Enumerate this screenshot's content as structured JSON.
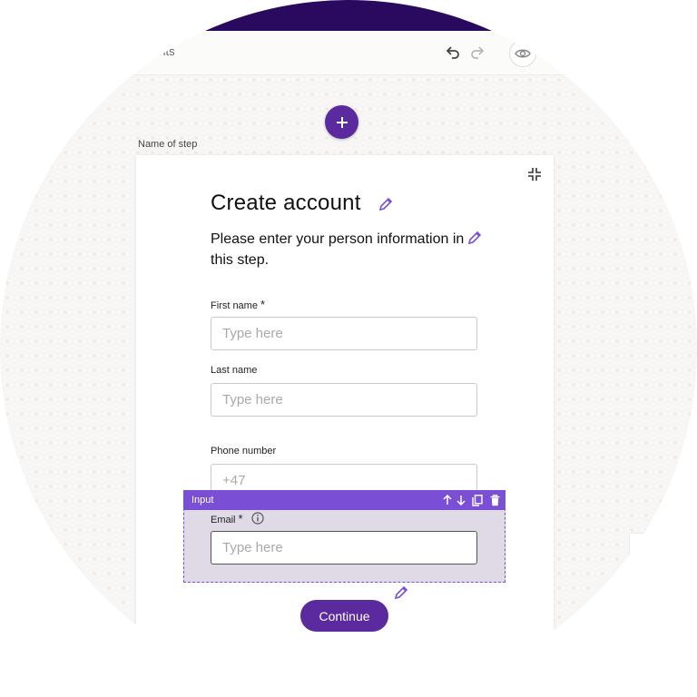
{
  "toolbar": {
    "title": "ements",
    "undo_icon": "undo-icon",
    "redo_icon": "redo-icon",
    "preview_icon": "eye-icon"
  },
  "canvas": {
    "add_step_icon": "plus-icon",
    "step_name": "Name of step"
  },
  "form": {
    "title": "Create account",
    "description": "Please enter your person information in this step.",
    "fields": [
      {
        "label": "First name",
        "required": "*",
        "placeholder": "Type here",
        "value": ""
      },
      {
        "label": "Last name",
        "required": "",
        "placeholder": "Type here",
        "value": ""
      },
      {
        "label": "Phone number",
        "required": "",
        "placeholder": "",
        "value": "+47"
      },
      {
        "label": "Email",
        "required": "*",
        "placeholder": "Type here",
        "value": ""
      }
    ],
    "continue_label": "Continue"
  },
  "selection": {
    "type_label": "Input",
    "actions": [
      "move-up-icon",
      "move-down-icon",
      "duplicate-icon",
      "delete-icon"
    ]
  },
  "colors": {
    "brand_purple": "#5b2a9e",
    "selection_purple": "#7a4fd6",
    "selection_fill": "#e0d9e6",
    "header_dark": "#2a0a5e"
  }
}
